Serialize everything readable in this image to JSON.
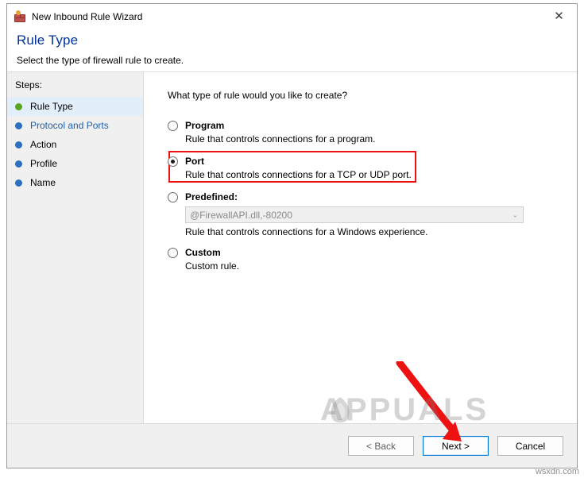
{
  "window": {
    "title": "New Inbound Rule Wizard",
    "icon": "firewall-brick-icon",
    "close_label": "✕"
  },
  "header": {
    "title": "Rule Type",
    "subtitle": "Select the type of firewall rule to create."
  },
  "steps": {
    "label": "Steps:",
    "items": [
      {
        "label": "Rule Type",
        "state": "active",
        "dot": "green"
      },
      {
        "label": "Protocol and Ports",
        "state": "link",
        "dot": "blue"
      },
      {
        "label": "Action",
        "state": "normal",
        "dot": "blue"
      },
      {
        "label": "Profile",
        "state": "normal",
        "dot": "blue"
      },
      {
        "label": "Name",
        "state": "normal",
        "dot": "blue"
      }
    ]
  },
  "main": {
    "question": "What type of rule would you like to create?",
    "options": [
      {
        "title": "Program",
        "description": "Rule that controls connections for a program.",
        "checked": false
      },
      {
        "title": "Port",
        "description": "Rule that controls connections for a TCP or UDP port.",
        "checked": true,
        "highlighted": true
      },
      {
        "title": "Predefined:",
        "description": "Rule that controls connections for a Windows experience.",
        "checked": false,
        "combo_value": "@FirewallAPI.dll,-80200",
        "combo_arrow": "⌄"
      },
      {
        "title": "Custom",
        "description": "Custom rule.",
        "checked": false
      }
    ]
  },
  "footer": {
    "back_label": "< Back",
    "next_label": "Next >",
    "cancel_label": "Cancel"
  },
  "annotations": {
    "arrow_color": "#ee1111",
    "highlight_color": "#ee1111",
    "watermark_text": "APPUALS",
    "site_url": "wsxdn.com"
  }
}
